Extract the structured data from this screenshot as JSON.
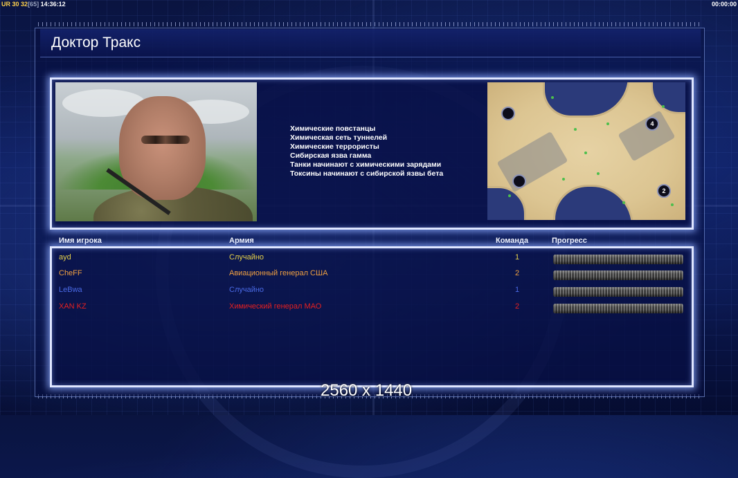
{
  "hud": {
    "tag": "UR",
    "value1": "30",
    "value2": "32",
    "bracket": "[65]",
    "clock": "14:36:12",
    "timer": "00:00:00"
  },
  "title": "Доктор Тракс",
  "traits": [
    "Химические повстанцы",
    "Химическая сеть туннелей",
    "Химические террористы",
    "Сибирская язва гамма",
    "Танки начинают с химическими зарядами",
    "Токсины начинают с сибирской язвы бета"
  ],
  "map": {
    "spawns": [
      "",
      "4",
      "",
      "2"
    ]
  },
  "table": {
    "headers": {
      "player": "Имя игрока",
      "army": "Армия",
      "team": "Команда",
      "progress": "Прогресс"
    },
    "rows": [
      {
        "name": "ayd",
        "army": "Случайно",
        "team": "1",
        "color": "#e6d24a",
        "progress": 1.0
      },
      {
        "name": "CheFF",
        "army": "Авиационный генерал США",
        "team": "2",
        "color": "#f0a040",
        "progress": 1.0
      },
      {
        "name": "LeBwa",
        "army": "Случайно",
        "team": "1",
        "color": "#4a6ae6",
        "progress": 1.0
      },
      {
        "name": "XAN KZ",
        "army": "Химический генерал МАО",
        "team": "2",
        "color": "#e62020",
        "progress": 1.0
      }
    ]
  },
  "resolution_caption": "2560 x 1440"
}
